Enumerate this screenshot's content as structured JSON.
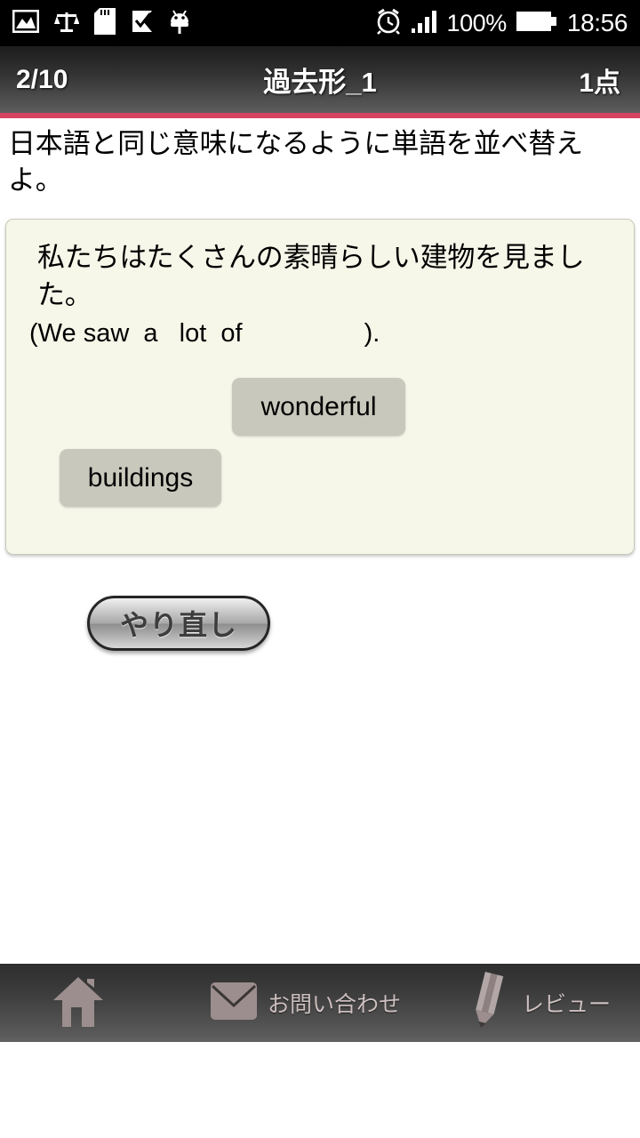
{
  "status_bar": {
    "icons_left": [
      "photo-icon",
      "scales-icon",
      "sd-card-icon",
      "check-flag-icon",
      "android-bug-icon"
    ],
    "alarm_icon": "alarm-clock-icon",
    "signal_icon": "signal-bars-icon",
    "battery_percent": "100%",
    "battery_icon": "battery-full-icon",
    "clock": "18:56"
  },
  "header": {
    "progress": "2/10",
    "title": "過去形_1",
    "score": "1点",
    "accent_color": "#d6445f"
  },
  "instruction": {
    "text": "日本語と同じ意味になるように単語を並べ替えよ。"
  },
  "question": {
    "japanese_sentence": "私たちはたくさんの素晴らしい建物を見ました。",
    "english_template": "(We saw  a   lot  of                 ).",
    "card_bg": "#f6f6e9",
    "tiles": [
      {
        "label": "wonderful"
      },
      {
        "label": "buildings"
      }
    ],
    "tile_color": "#c9c8bc"
  },
  "reset_button": {
    "label": "やり直し"
  },
  "bottom_nav": {
    "items": [
      {
        "icon": "home-icon",
        "label": ""
      },
      {
        "icon": "envelope-icon",
        "label": "お問い合わせ"
      },
      {
        "icon": "pencil-icon",
        "label": "レビュー"
      }
    ],
    "icon_color": "#9c8e8e"
  }
}
